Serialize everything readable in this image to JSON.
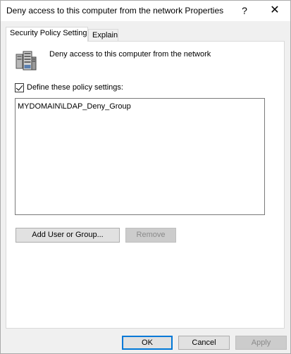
{
  "window": {
    "title": "Deny access to this computer from the network Properties",
    "help_glyph": "?",
    "close_glyph": "✕"
  },
  "tabs": [
    {
      "label": "Security Policy Setting",
      "active": true
    },
    {
      "label": "Explain",
      "active": false
    }
  ],
  "policy": {
    "icon": "server-computer-icon",
    "name": "Deny access to this computer from the network"
  },
  "define_checkbox": {
    "label": "Define these policy settings:",
    "checked": true
  },
  "members": [
    "MYDOMAIN\\LDAP_Deny_Group"
  ],
  "buttons": {
    "add": "Add User or Group...",
    "remove": "Remove",
    "ok": "OK",
    "cancel": "Cancel",
    "apply": "Apply"
  },
  "colors": {
    "focus_border": "#0078d7"
  }
}
